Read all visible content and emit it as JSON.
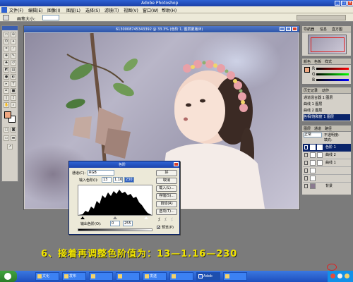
{
  "window": {
    "title": "Adobe Photoshop"
  },
  "menu": [
    "文件(F)",
    "编辑(E)",
    "图像(I)",
    "图层(L)",
    "选择(S)",
    "滤镜(T)",
    "视图(V)",
    "窗口(W)",
    "帮助(H)"
  ],
  "options": {
    "label": "画笔大小:"
  },
  "document": {
    "title": "6130008745343392 @ 33.3% (色阶 1, 图层蒙版/8)"
  },
  "navigator": {
    "tabs": [
      "导航器",
      "信息",
      "直方图"
    ]
  },
  "color_panel": {
    "tabs": [
      "颜色",
      "色板",
      "样式"
    ],
    "r": "R",
    "g": "G",
    "b": "B"
  },
  "history": {
    "tabs": [
      "历史记录",
      "动作"
    ],
    "items": [
      "通道混合器 1 图层",
      "曲线 1 图层",
      "曲线 2 图层",
      "色相/饱和度 1 图层"
    ]
  },
  "layers": {
    "tabs": [
      "图层",
      "通道",
      "路径"
    ],
    "mode": "正常",
    "opacity_label": "不透明度:",
    "fill_label": "填充:",
    "rows": [
      {
        "name": "色阶 1"
      },
      {
        "name": "曲线 2"
      },
      {
        "name": "曲线 1"
      },
      {
        "name": ""
      },
      {
        "name": ""
      },
      {
        "name": "背景"
      }
    ]
  },
  "levels_dialog": {
    "title": "色阶",
    "channel_label": "通道(C):",
    "channel_value": "RGB",
    "input_label": "输入色阶(I):",
    "input_values": [
      "13",
      "1.16",
      "230"
    ],
    "output_label": "输出色阶(O):",
    "output_values": [
      "0",
      "255"
    ],
    "buttons": [
      "好",
      "取消",
      "载入(L)...",
      "存储(S)...",
      "自动(A)",
      "选项(T)..."
    ],
    "preview_label": "预览(P)"
  },
  "caption": "6、接着再调整色阶值为：13—1.16—230",
  "taskbar": {
    "buttons": [
      "文化",
      "发布",
      "",
      "",
      "发送",
      "",
      "Adob",
      ""
    ]
  },
  "colors": {
    "caption": "#f3e600",
    "titlebar": "#1f49b4",
    "foreground_swatch": "#f0a882"
  }
}
